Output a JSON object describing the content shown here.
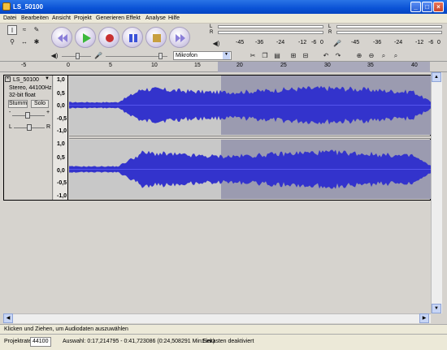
{
  "window": {
    "title": "LS_50100"
  },
  "menu": [
    "Datei",
    "Bearbeiten",
    "Ansicht",
    "Projekt",
    "Generieren",
    "Effekt",
    "Analyse",
    "Hilfe"
  ],
  "meter": {
    "scale_play": [
      "-45",
      "-36",
      "-24",
      "-12",
      "-6",
      "0"
    ],
    "scale_rec": [
      "-45",
      "-36",
      "-24",
      "-12",
      "-6",
      "0"
    ],
    "L": "L",
    "R": "R"
  },
  "mixer": {
    "input_source": "Mikrofon"
  },
  "ruler": [
    "-5",
    "0",
    "5",
    "10",
    "15",
    "20",
    "25",
    "30",
    "35",
    "40"
  ],
  "track": {
    "name": "LS_50100",
    "format": "Stereo, 44100Hz",
    "bits": "32-bit float",
    "mute": "Stumm",
    "solo": "Solo",
    "pan_l": "L",
    "pan_r": "R",
    "gain_minus": "-",
    "gain_plus": "+",
    "scale": [
      "1,0",
      "0,5",
      "0,0",
      "-0,5",
      "-1,0"
    ]
  },
  "status": {
    "hint": "Klicken und Ziehen, um Audiodaten auszuwählen",
    "rate_label": "Projektrate:",
    "rate_value": "44100",
    "selection": "Auswahl: 0:17,214795 - 0:41,723086 (0:24,508291 Min:Sek)",
    "snap": "Einrasten deaktiviert"
  },
  "colors": {
    "waveform": "#3333cc",
    "selection": "#9b9bb0",
    "title_bar": "#0a52d6"
  }
}
